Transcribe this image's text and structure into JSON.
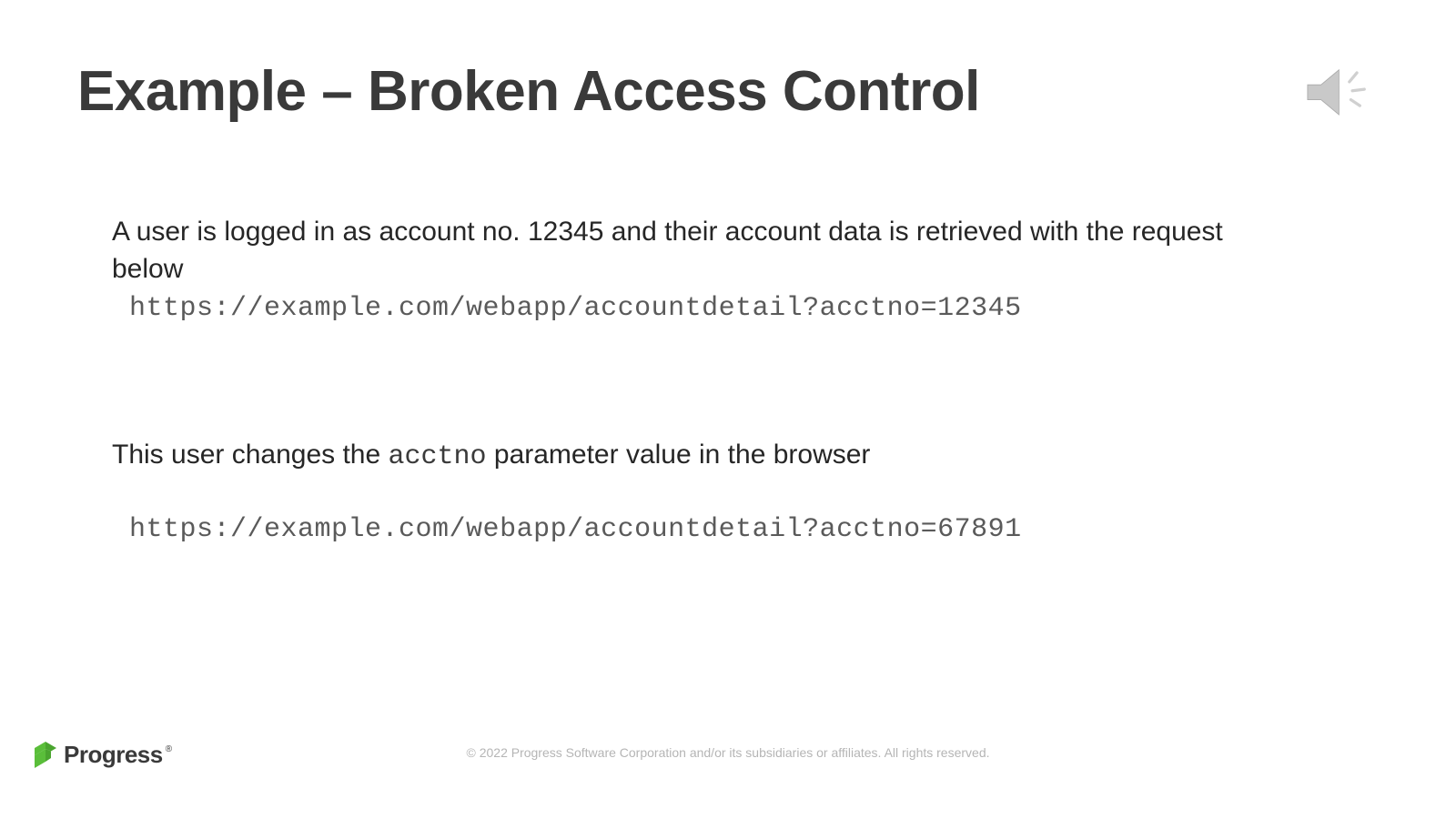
{
  "title": "Example – Broken Access Control",
  "paragraph1": "A user is logged in as account no. 12345 and their account data is retrieved with the request below",
  "url1": "https://example.com/webapp/accountdetail?acctno=12345",
  "paragraph2_prefix": "This user changes the ",
  "paragraph2_code": "acctno",
  "paragraph2_suffix": " parameter value in the browser",
  "url2": "https://example.com/webapp/accountdetail?acctno=67891",
  "footer": "© 2022 Progress Software Corporation and/or its subsidiaries or affiliates. All rights reserved.",
  "logo_text": "Progress",
  "logo_reg": "®"
}
